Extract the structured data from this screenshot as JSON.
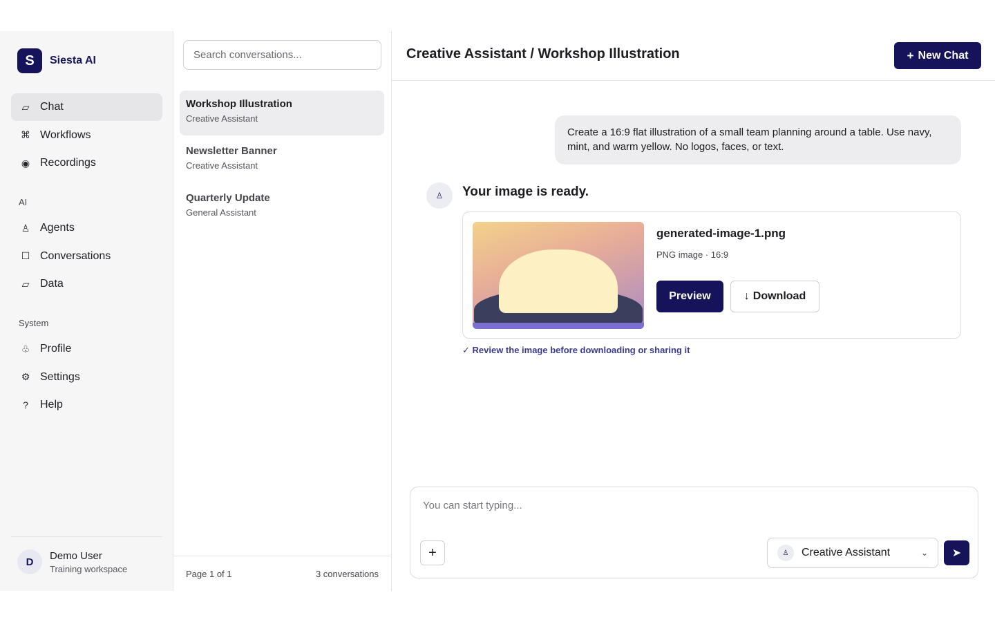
{
  "brand": {
    "logo_letter": "S",
    "name": "Siesta AI"
  },
  "sidebar": {
    "main_items": [
      {
        "label": "Chat",
        "icon": "chat-icon",
        "glyph": "▱",
        "active": true
      },
      {
        "label": "Workflows",
        "icon": "command-icon",
        "glyph": "⌘"
      },
      {
        "label": "Recordings",
        "icon": "record-icon",
        "glyph": "◉"
      }
    ],
    "ai_section": "AI",
    "ai_items": [
      {
        "label": "Agents",
        "icon": "agent-icon",
        "glyph": "♙"
      },
      {
        "label": "Conversations",
        "icon": "square-icon",
        "glyph": "☐"
      },
      {
        "label": "Data",
        "icon": "data-icon",
        "glyph": "▱"
      }
    ],
    "system_section": "System",
    "system_items": [
      {
        "label": "Profile",
        "icon": "profile-icon",
        "glyph": "♧"
      },
      {
        "label": "Settings",
        "icon": "gear-icon",
        "glyph": "⚙"
      },
      {
        "label": "Help",
        "icon": "help-icon",
        "glyph": "?"
      }
    ],
    "user": {
      "initial": "D",
      "name": "Demo User",
      "workspace": "Training workspace"
    }
  },
  "conversations": {
    "search_placeholder": "Search conversations...",
    "items": [
      {
        "title": "Workshop Illustration",
        "agent": "Creative Assistant",
        "active": true
      },
      {
        "title": "Newsletter Banner",
        "agent": "Creative Assistant"
      },
      {
        "title": "Quarterly Update",
        "agent": "General Assistant"
      }
    ],
    "page_info": "Page 1 of 1",
    "count": "3 conversations"
  },
  "header": {
    "breadcrumb": "Creative Assistant / Workshop Illustration",
    "new_chat_label": "New Chat",
    "new_chat_glyph": "+"
  },
  "messages": {
    "user_prompt": "Create a 16:9 flat illustration of a small team planning around a table. Use navy, mint, and warm yellow. No logos, faces, or text.",
    "assistant_glyph": "♙",
    "assistant_title": "Your image is ready.",
    "attachment": {
      "file_name": "generated-image-1.png",
      "meta": "PNG image · 16:9",
      "preview_label": "Preview",
      "download_label": "Download",
      "download_glyph": "↓"
    },
    "review_note": "✓ Review the image before downloading or sharing it"
  },
  "composer": {
    "placeholder": "You can start typing...",
    "attach_glyph": "+",
    "agent_glyph": "♙",
    "agent_label": "Creative Assistant",
    "chevron_glyph": "⌄",
    "send_glyph": "➤"
  },
  "colors": {
    "brand": "#15135a",
    "sidebar_bg": "#f6f6f7",
    "active_bg": "#e6e6e8",
    "accent_text": "#3a3a8c"
  }
}
